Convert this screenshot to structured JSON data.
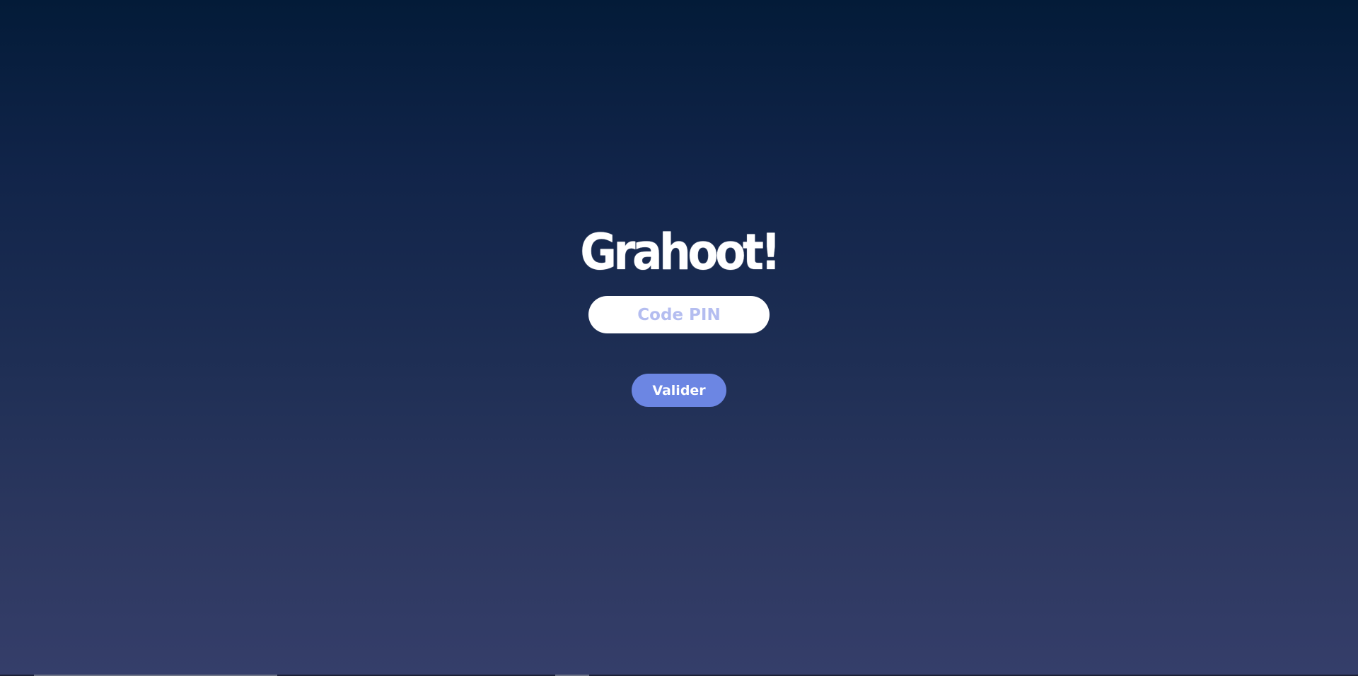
{
  "app": {
    "logo_text": "Grahoot!"
  },
  "form": {
    "pin_placeholder": "Code PIN",
    "pin_value": "",
    "submit_label": "Valider"
  },
  "colors": {
    "background_top": "#031b38",
    "background_bottom": "#353e6a",
    "button": "#6c86e3",
    "placeholder": "#b4bdf0",
    "input_background": "#ffffff"
  }
}
